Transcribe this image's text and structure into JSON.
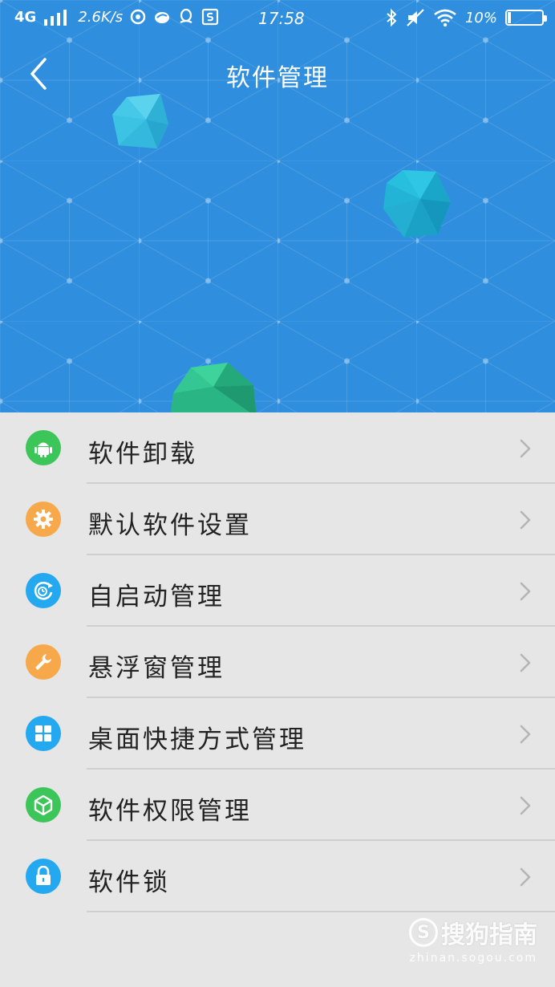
{
  "status_bar": {
    "network": "4G",
    "speed": "2.6K/s",
    "time": "17:58",
    "battery": "10%",
    "battery_level": 0.1
  },
  "header": {
    "title": "软件管理",
    "background_color": "#2f8fde"
  },
  "menu": {
    "items": [
      {
        "label": "软件卸载",
        "icon": "android-icon",
        "color": "#3cc65a"
      },
      {
        "label": "默认软件设置",
        "icon": "gear-icon",
        "color": "#f6a84a"
      },
      {
        "label": "自启动管理",
        "icon": "power-clock-icon",
        "color": "#24a8f0"
      },
      {
        "label": "悬浮窗管理",
        "icon": "wrench-icon",
        "color": "#f6a84a"
      },
      {
        "label": "桌面快捷方式管理",
        "icon": "grid-icon",
        "color": "#24a8f0"
      },
      {
        "label": "软件权限管理",
        "icon": "cube-icon",
        "color": "#3cc65a"
      },
      {
        "label": "软件锁",
        "icon": "lock-icon",
        "color": "#24a8f0"
      }
    ]
  },
  "watermark": {
    "brand": "搜狗指南",
    "url": "zhinan.sogou.com",
    "logo_letter": "S"
  }
}
